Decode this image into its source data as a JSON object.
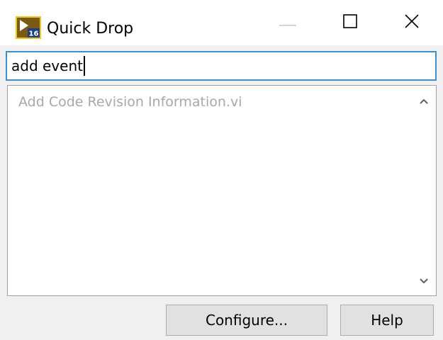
{
  "window": {
    "title": "Quick Drop"
  },
  "icons": {
    "app": "labview-vi-icon",
    "minimize": "minimize-icon",
    "maximize": "maximize-icon",
    "close": "close-icon",
    "scroll_up": "chevron-up-icon",
    "scroll_down": "chevron-down-icon"
  },
  "search": {
    "value": "add event"
  },
  "results": {
    "items": [
      {
        "label": "Add Code Revision Information.vi"
      }
    ]
  },
  "buttons": {
    "configure_label": "Configure...",
    "help_label": "Help"
  },
  "colors": {
    "focus_border": "#3c8fd3",
    "result_text": "#a8a8a8",
    "button_face": "#e1e1e1",
    "window_bg": "#f0f0f0"
  }
}
